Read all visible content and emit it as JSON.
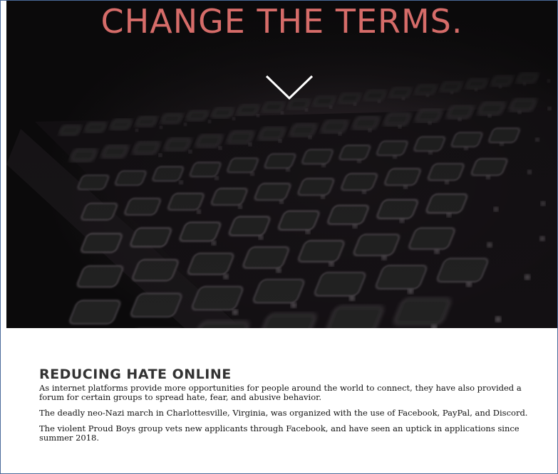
{
  "hero": {
    "headline": "CHANGE THE TERMS.",
    "scroll_icon": "chevron-down-icon",
    "headline_color": "#d66c69",
    "background_color": "#0b0a0b"
  },
  "section": {
    "title": "REDUCING HATE ONLINE",
    "paragraphs": [
      "As internet platforms provide more opportunities for people around the world to connect, they have also provided a forum for certain groups to spread hate, fear, and abusive behavior.",
      "The deadly neo-Nazi march in Charlottesville, Virginia, was organized with the use of Facebook, PayPal, and Discord.",
      "The violent Proud Boys group vets new applicants through Facebook, and have seen an uptick in applications since summer 2018."
    ]
  }
}
